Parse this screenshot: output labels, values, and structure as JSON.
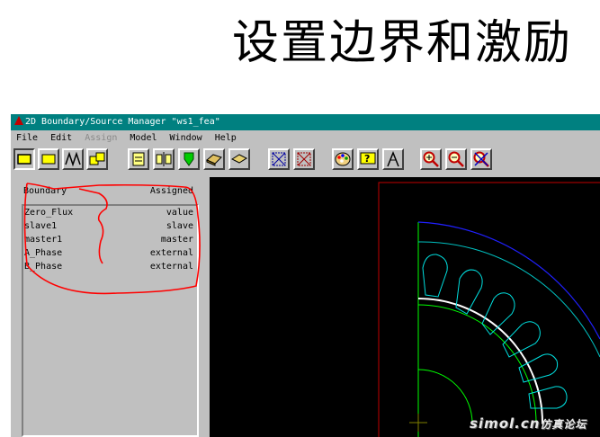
{
  "slide_title": "设置边界和激励",
  "window": {
    "title": "2D Boundary/Source Manager \"ws1_fea\""
  },
  "menu": [
    "File",
    "Edit",
    "Assign",
    "Model",
    "Window",
    "Help"
  ],
  "menu_disabled": "Assign",
  "toolbar": {
    "buttons": [
      "boundary-select",
      "source-select",
      "line-select",
      "region-select",
      "assign-value",
      "split-view",
      "marker-tool",
      "object-tool",
      "edge-tool",
      "fit-box",
      "zoom-out-box",
      "color-palette",
      "help-query",
      "measure-tool",
      "zoom-in",
      "zoom-out",
      "fit-all"
    ]
  },
  "panel": {
    "col_boundary": "Boundary",
    "col_assigned": "Assigned",
    "rows": [
      {
        "name": "Zero_Flux",
        "assigned": "value"
      },
      {
        "name": "slave1",
        "assigned": "slave"
      },
      {
        "name": "master1",
        "assigned": "master"
      },
      {
        "name": "A_Phase",
        "assigned": "external"
      },
      {
        "name": "B_Phase",
        "assigned": "external"
      }
    ]
  },
  "colors": {
    "titlebar": "#008080",
    "canvas_bg": "#000000",
    "stator_outline": "#0000ff",
    "slots": "#00ffff",
    "rotor": "#00ff00",
    "annotation": "#ff0000"
  },
  "watermark": "simol.cn仿真论坛"
}
